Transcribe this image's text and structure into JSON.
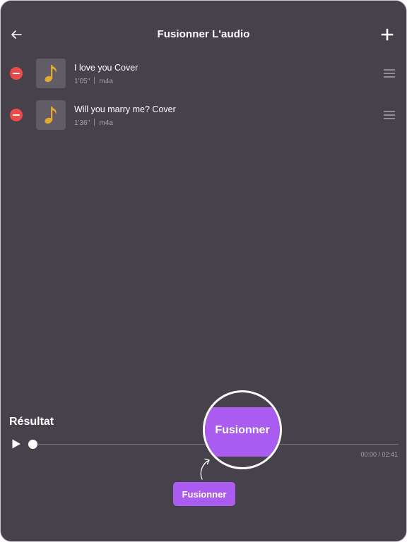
{
  "header": {
    "title": "Fusionner L'audio",
    "back_icon": "arrow-left-icon",
    "add_icon": "plus-icon"
  },
  "tracks": [
    {
      "name": "I love you Cover",
      "duration": "1'05''",
      "format": "m4a",
      "thumb_icon": "music-note-icon"
    },
    {
      "name": "Will you marry me? Cover",
      "duration": "1'36''",
      "format": "m4a",
      "thumb_icon": "music-note-icon"
    }
  ],
  "result": {
    "title": "Résultat",
    "time": "00:00 / 02:41",
    "progress": 0
  },
  "zoom_callout": {
    "label": "Fusionner"
  },
  "merge_button": {
    "label": "Fusionner"
  },
  "colors": {
    "background": "#47414b",
    "accent": "#ab5cf0",
    "remove": "#ed4b4b",
    "note": "#e4aa2f",
    "thumb_bg": "#625c67"
  }
}
